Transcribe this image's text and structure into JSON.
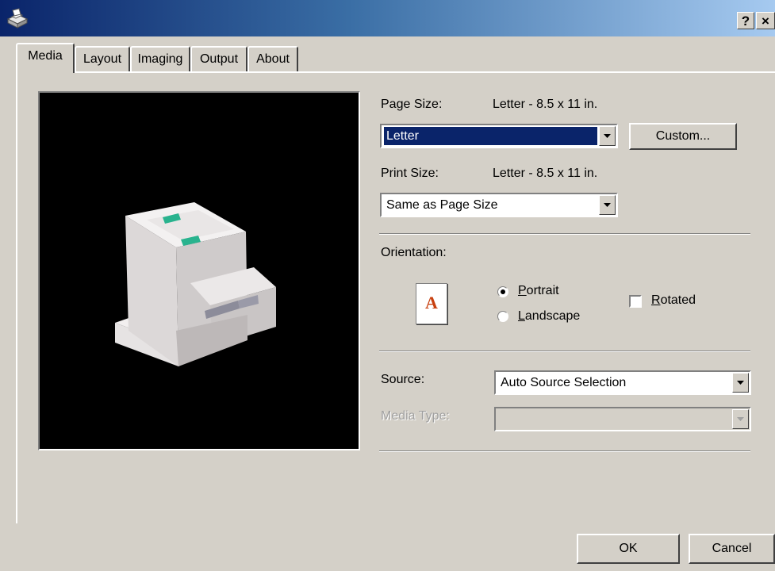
{
  "titlebar": {
    "help_label": "?",
    "close_label": "×",
    "icon": "printer-icon"
  },
  "tabs": [
    {
      "label": "Media",
      "active": true
    },
    {
      "label": "Layout",
      "active": false
    },
    {
      "label": "Imaging",
      "active": false
    },
    {
      "label": "Output",
      "active": false
    },
    {
      "label": "About",
      "active": false
    }
  ],
  "page_size": {
    "label": "Page Size:",
    "value_text": "Letter - 8.5 x 11 in.",
    "selected": "Letter",
    "custom_button": "Custom..."
  },
  "print_size": {
    "label": "Print Size:",
    "value_text": "Letter - 8.5 x 11 in.",
    "selected": "Same as Page Size"
  },
  "orientation": {
    "label": "Orientation:",
    "preview_letter": "A",
    "portrait_first": "P",
    "portrait_rest": "ortrait",
    "landscape_first": "L",
    "landscape_rest": "andscape",
    "rotated_first": "R",
    "rotated_rest": "otated",
    "selected": "Portrait",
    "rotated_checked": false
  },
  "source": {
    "label": "Source:",
    "selected": "Auto Source Selection"
  },
  "media_type": {
    "label": "Media Type:",
    "selected": "",
    "disabled": true
  },
  "footer": {
    "ok_label": "OK",
    "cancel_label": "Cancel"
  },
  "colors": {
    "titlebar_start": "#0a246a",
    "titlebar_end": "#a6caf0",
    "selection": "#0a246a",
    "face": "#d4d0c8",
    "accent_red": "#c84010",
    "tray_green": "#29b38e"
  }
}
